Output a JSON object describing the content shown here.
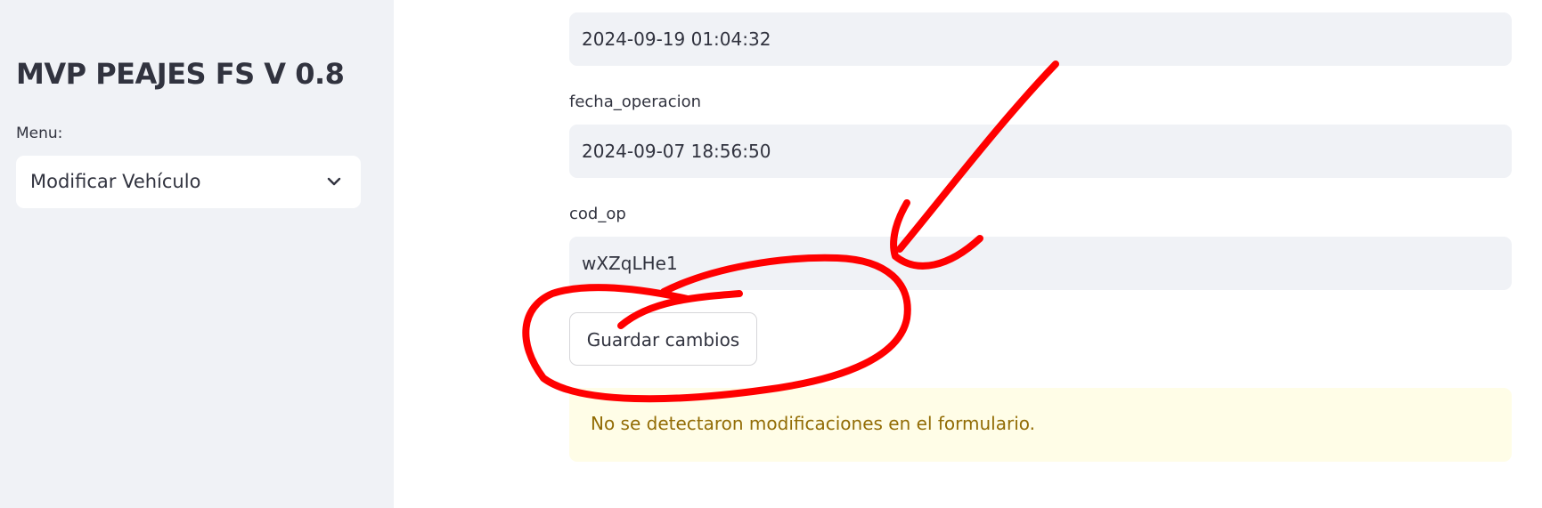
{
  "sidebar": {
    "title": "MVP PEAJES FS V 0.8",
    "menu_label": "Menu:",
    "menu_selected": "Modificar Vehículo"
  },
  "form": {
    "fields": [
      {
        "label": "",
        "value": "2024-09-19 01:04:32"
      },
      {
        "label": "fecha_operacion",
        "value": "2024-09-07 18:56:50"
      },
      {
        "label": "cod_op",
        "value": "wXZqLHe1"
      }
    ],
    "save_label": "Guardar cambios",
    "warning_message": "No se detectaron modificaciones en el formulario."
  },
  "colors": {
    "sidebar_bg": "#f0f2f6",
    "input_bg": "#f0f2f6",
    "warning_bg": "#fffde7",
    "warning_text": "#926c05",
    "annotation": "#ff0000"
  },
  "icons": {
    "menu_select": "chevron-down-icon"
  }
}
